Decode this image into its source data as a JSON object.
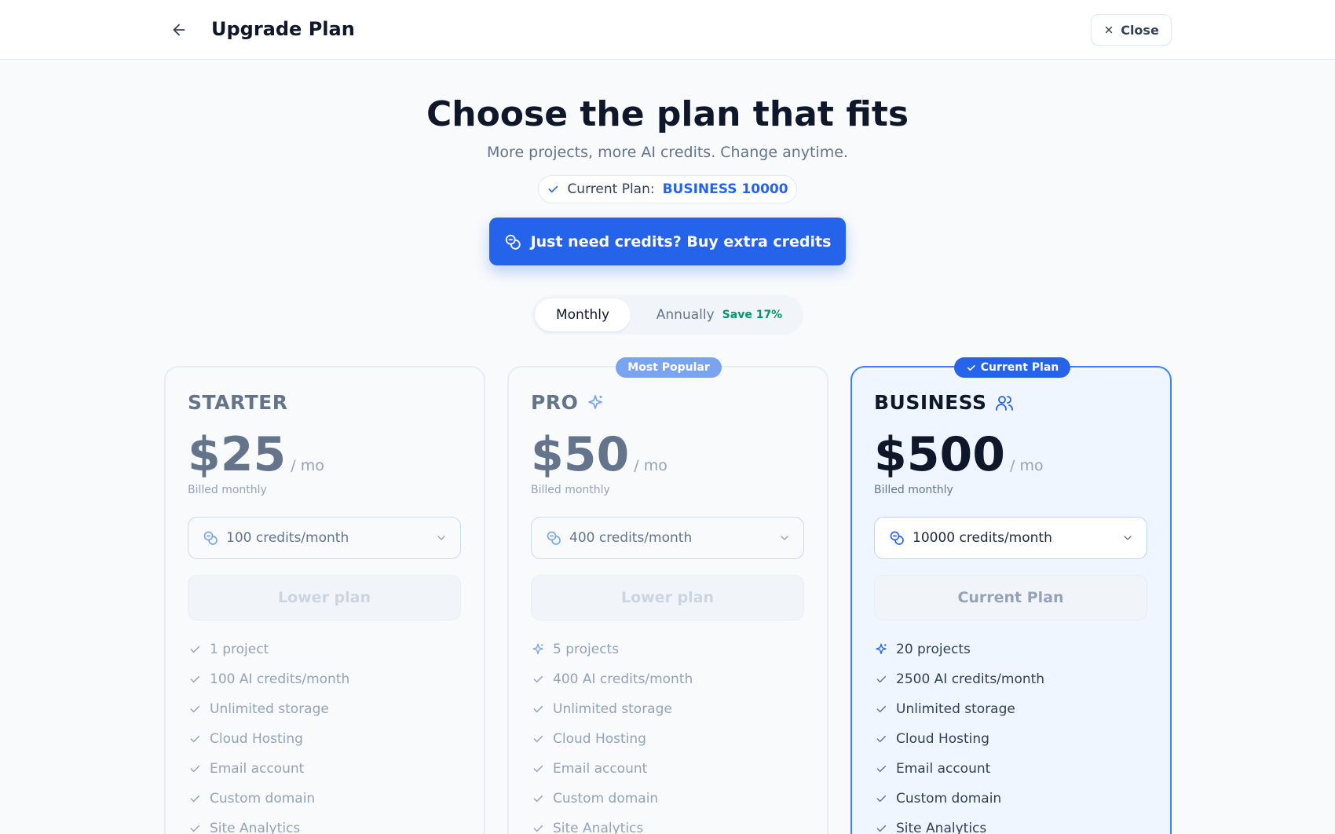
{
  "header": {
    "title": "Upgrade Plan",
    "close_label": "Close"
  },
  "hero": {
    "title": "Choose the plan that fits",
    "subtitle": "More projects, more AI credits. Change anytime.",
    "current_plan_label": "Current Plan:",
    "current_plan_value": "BUSINESS 10000",
    "buy_credits_label": "Just need credits? Buy extra credits"
  },
  "billing": {
    "monthly_label": "Monthly",
    "annual_label": "Annually",
    "save_label": "Save 17%",
    "selected": "Monthly"
  },
  "colors": {
    "accent": "#2563eb",
    "save_green": "#059669"
  },
  "plans": [
    {
      "name": "STARTER",
      "icon": "none",
      "price": "$25",
      "per": "/ mo",
      "billed": "Billed monthly",
      "credits": "100 credits/month",
      "action": "Lower plan",
      "features": [
        {
          "text": "1 project",
          "icon": "check-icon"
        },
        {
          "text": "100 AI credits/month",
          "icon": "check-icon"
        },
        {
          "text": "Unlimited storage",
          "icon": "check-icon"
        },
        {
          "text": "Cloud Hosting",
          "icon": "check-icon"
        },
        {
          "text": "Email account",
          "icon": "check-icon"
        },
        {
          "text": "Custom domain",
          "icon": "check-icon"
        },
        {
          "text": "Site Analytics",
          "icon": "check-icon"
        }
      ]
    },
    {
      "name": "PRO",
      "icon": "sparkle-icon",
      "badge": "Most Popular",
      "price": "$50",
      "per": "/ mo",
      "billed": "Billed monthly",
      "credits": "400 credits/month",
      "action": "Lower plan",
      "features": [
        {
          "text": "5 projects",
          "icon": "sparkle-icon"
        },
        {
          "text": "400 AI credits/month",
          "icon": "check-icon"
        },
        {
          "text": "Unlimited storage",
          "icon": "check-icon"
        },
        {
          "text": "Cloud Hosting",
          "icon": "check-icon"
        },
        {
          "text": "Email account",
          "icon": "check-icon"
        },
        {
          "text": "Custom domain",
          "icon": "check-icon"
        },
        {
          "text": "Site Analytics",
          "icon": "check-icon"
        }
      ]
    },
    {
      "name": "BUSINESS",
      "icon": "users-icon",
      "badge": "Current Plan",
      "price": "$500",
      "per": "/ mo",
      "billed": "Billed monthly",
      "credits": "10000 credits/month",
      "action": "Current Plan",
      "features": [
        {
          "text": "20 projects",
          "icon": "sparkle-icon"
        },
        {
          "text": "2500 AI credits/month",
          "icon": "check-icon"
        },
        {
          "text": "Unlimited storage",
          "icon": "check-icon"
        },
        {
          "text": "Cloud Hosting",
          "icon": "check-icon"
        },
        {
          "text": "Email account",
          "icon": "check-icon"
        },
        {
          "text": "Custom domain",
          "icon": "check-icon"
        },
        {
          "text": "Site Analytics",
          "icon": "check-icon"
        }
      ]
    }
  ]
}
